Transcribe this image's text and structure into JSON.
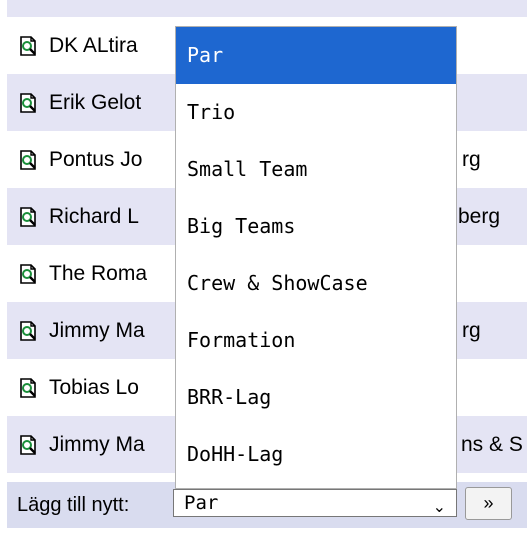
{
  "list": {
    "partial_top_row": "",
    "rows": [
      {
        "text": "DK ALtira"
      },
      {
        "text": "Erik Gelot"
      },
      {
        "text": "Pontus Jo",
        "tail": "rg"
      },
      {
        "text": "Richard L",
        "tail": "berg"
      },
      {
        "text": "The Roma"
      },
      {
        "text": "Jimmy Ma",
        "tail": "rg"
      },
      {
        "text": "Tobias Lo"
      },
      {
        "text": "Jimmy Ma",
        "tail": "ns & S"
      }
    ]
  },
  "footer": {
    "label": "Lägg till nytt:",
    "selected_value": "Par",
    "arrow": "⌄",
    "button_label": "»"
  },
  "dropdown": {
    "options": [
      {
        "label": "Par",
        "selected": true
      },
      {
        "label": "Trio"
      },
      {
        "label": "Small Team"
      },
      {
        "label": "Big Teams"
      },
      {
        "label": "Crew & ShowCase"
      },
      {
        "label": "Formation"
      },
      {
        "label": "BRR-Lag"
      },
      {
        "label": "DoHH-Lag"
      }
    ]
  },
  "colors": {
    "row_alt": "#e4e4f4",
    "footer_bg": "#d9dcef",
    "selected_option_bg": "#1e67d0"
  }
}
